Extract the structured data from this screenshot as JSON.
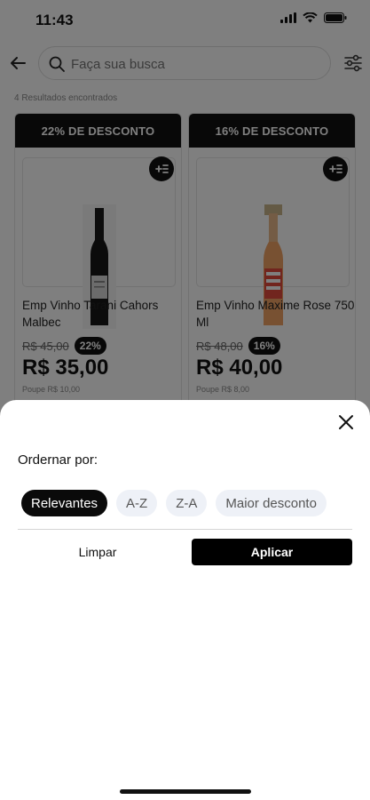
{
  "status_bar": {
    "time": "11:43"
  },
  "search": {
    "placeholder": "Faça sua busca"
  },
  "results": {
    "count_text": "4 Resultados encontrados"
  },
  "products": [
    {
      "discount_banner": "22% DE DESCONTO",
      "name": "Emp Vinho Tarani Cahors Malbec",
      "old_price": "R$ 45,00",
      "discount_pill": "22%",
      "price": "R$ 35,00",
      "savings": "Poupe R$ 10,00"
    },
    {
      "discount_banner": "16% DE DESCONTO",
      "name": "Emp Vinho Maxime Rose 750 Ml",
      "old_price": "R$ 48,00",
      "discount_pill": "16%",
      "price": "R$ 40,00",
      "savings": "Poupe R$ 8,00"
    }
  ],
  "sort_sheet": {
    "title": "Ordernar por:",
    "options": [
      {
        "label": "Relevantes",
        "selected": true
      },
      {
        "label": "A-Z",
        "selected": false
      },
      {
        "label": "Z-A",
        "selected": false
      },
      {
        "label": "Maior desconto",
        "selected": false
      }
    ],
    "clear_label": "Limpar",
    "apply_label": "Aplicar"
  },
  "icons": {
    "back": "arrow-left-icon",
    "search": "search-icon",
    "filter": "sliders-icon",
    "add_to_list": "add-list-icon",
    "close": "close-icon"
  },
  "colors": {
    "primary": "#000000",
    "chip_inactive_bg": "#eef1f7",
    "overlay": "rgba(0,0,0,0.5)"
  }
}
